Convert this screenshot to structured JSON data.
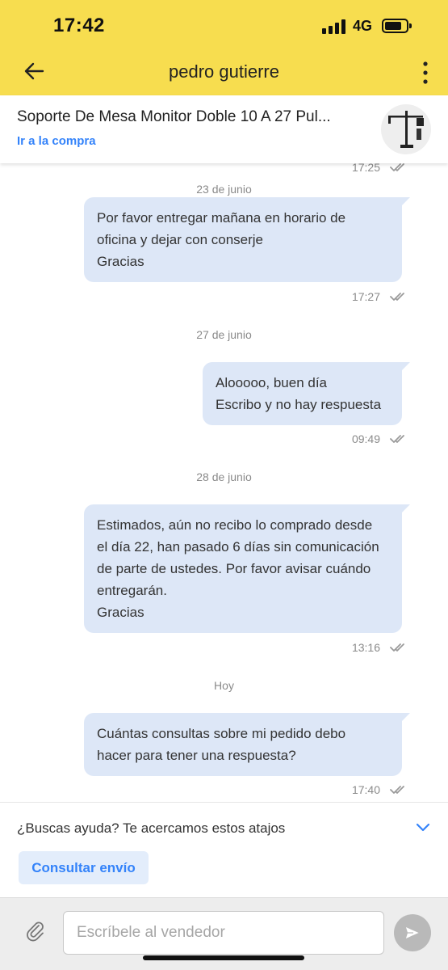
{
  "status_bar": {
    "time": "17:42",
    "network": "4G"
  },
  "header": {
    "title": "pedro gutierre"
  },
  "product": {
    "title": "Soporte De Mesa Monitor Doble 10 A 27 Pul...",
    "link": "Ir a la compra"
  },
  "chat": {
    "top_time": "17:25",
    "groups": [
      {
        "date": "23 de junio",
        "lines": [
          "Por favor entregar mañana en horario de",
          "oficina y dejar con conserje",
          "Gracias"
        ],
        "time": "17:27"
      },
      {
        "date": "27 de junio",
        "lines": [
          "Alooooo, buen día",
          "Escribo y no hay respuesta"
        ],
        "time": "09:49"
      },
      {
        "date": "28 de junio",
        "lines": [
          "Estimados, aún no recibo lo comprado desde",
          "el día 22, han pasado 6 días sin comunicación",
          "de parte de ustedes. Por favor avisar cuándo",
          "entregarán.",
          "Gracias"
        ],
        "time": "13:16"
      },
      {
        "date": "Hoy",
        "lines": [
          "Cuántas consultas sobre mi pedido debo",
          "hacer para tener una respuesta?"
        ],
        "time": "17:40"
      }
    ]
  },
  "help": {
    "text": "¿Buscas ayuda? Te acercamos estos atajos",
    "quick_action": "Consultar envío"
  },
  "composer": {
    "placeholder": "Escríbele al vendedor"
  },
  "colors": {
    "header_bg": "#f7dd4f",
    "bubble_bg": "#dde7f7",
    "link": "#3483fa"
  },
  "icons": {
    "back": "arrow-left-icon",
    "more": "more-vertical-icon",
    "read": "double-check-icon",
    "expand": "chevron-down-icon",
    "attach": "paperclip-icon",
    "send": "send-icon"
  }
}
